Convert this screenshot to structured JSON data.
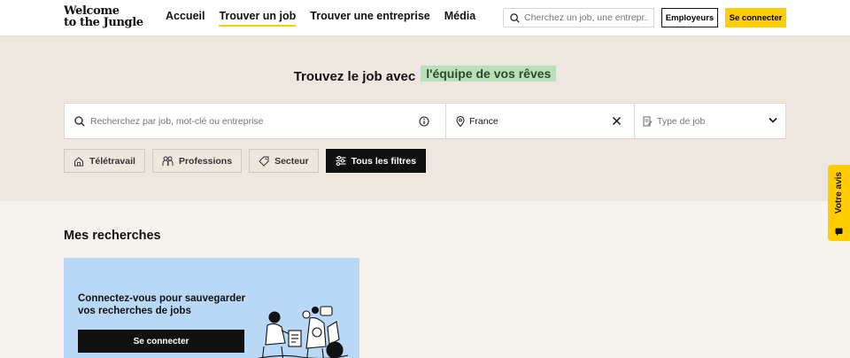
{
  "header": {
    "logo_line1": "Welcome",
    "logo_line2": "to the Jungle",
    "nav": [
      "Accueil",
      "Trouver un job",
      "Trouver une entreprise",
      "Média"
    ],
    "active_nav": "Trouver un job",
    "search_placeholder": "Cherchez un job, une entrepr...",
    "employer_label": "Employeurs",
    "login_label": "Se connecter"
  },
  "hero": {
    "title_part1": "Trouvez le job avec",
    "title_highlight": "l'équipe de vos rêves",
    "highlight_color": "#b8e0b9",
    "search": {
      "query_placeholder": "Recherchez par job, mot-clé ou entreprise",
      "location_value": "France",
      "type_placeholder": "Type de job"
    },
    "filters": [
      "Télétravail",
      "Professions",
      "Secteur",
      "Tous les filtres"
    ]
  },
  "saved_searches": {
    "title": "Mes recherches",
    "card_text": "Connectez-vous pour sauvegarder vos recherches de jobs",
    "card_button": "Se connecter",
    "card_color": "#b9d8f5"
  },
  "feedback": {
    "label": "Votre avis"
  },
  "colors": {
    "accent": "#ffcd00",
    "hero_bg": "#ede7df",
    "page_bg": "#f6f3ee"
  }
}
